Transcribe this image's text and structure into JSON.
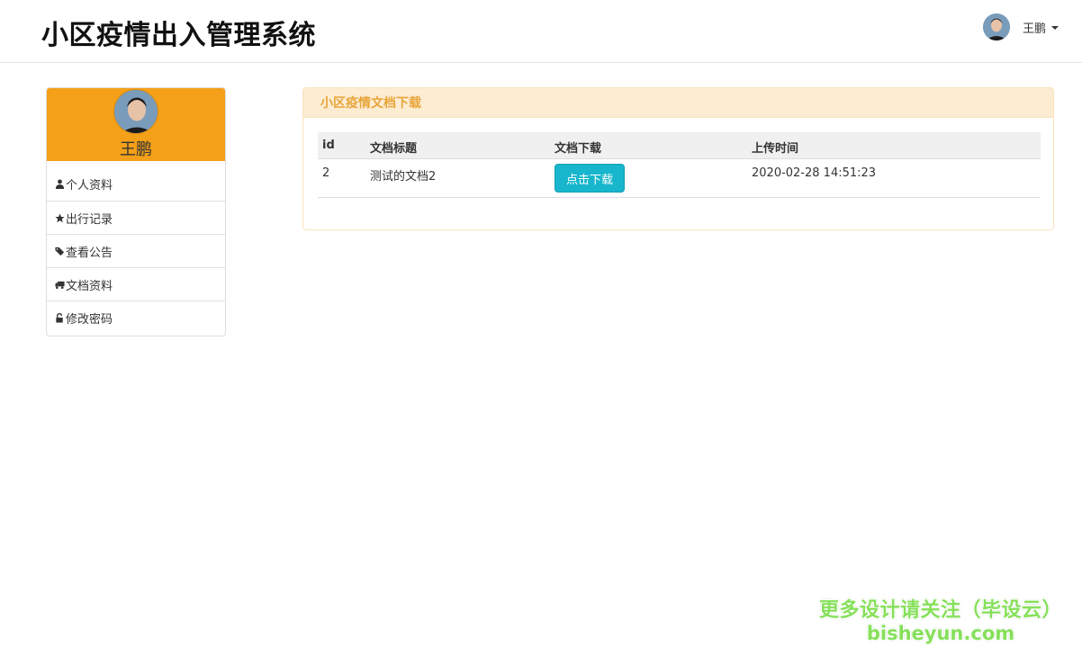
{
  "header": {
    "app_title": "小区疫情出入管理系统",
    "user_name": "王鹏"
  },
  "sidebar": {
    "profile_name": "王鹏",
    "items": [
      {
        "label": "个人资料",
        "icon": "user-icon"
      },
      {
        "label": "出行记录",
        "icon": "star-icon"
      },
      {
        "label": "查看公告",
        "icon": "tags-icon"
      },
      {
        "label": "文档资料",
        "icon": "truck-icon"
      },
      {
        "label": "修改密码",
        "icon": "unlock-icon"
      }
    ]
  },
  "panel": {
    "title": "小区疫情文档下载",
    "columns": [
      "id",
      "文档标题",
      "文档下载",
      "上传时间"
    ],
    "rows": [
      {
        "id": "2",
        "title": "测试的文档2",
        "download_label": "点击下载",
        "uploaded": "2020-02-28 14:51:23"
      }
    ]
  },
  "watermark": {
    "line1": "更多设计请关注（毕设云）",
    "line2": "bisheyun.com"
  },
  "colors": {
    "accent_orange": "#f4a018",
    "panel_heading_bg": "#fcecd2",
    "panel_heading_text": "#e8a53a",
    "button_cyan": "#17b6cc",
    "watermark_green": "#86e05a"
  }
}
